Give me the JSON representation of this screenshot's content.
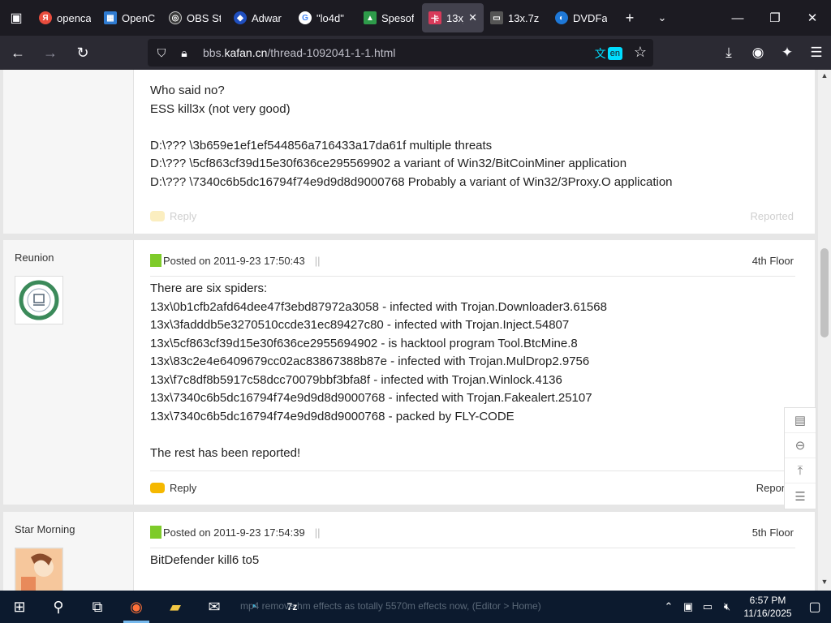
{
  "browser": {
    "tabs": [
      {
        "label": "openca",
        "favicon": "yandex-icon",
        "color": "#e84c3d"
      },
      {
        "label": "OpenC",
        "favicon": "windows-icon",
        "color": "#2f7bd1"
      },
      {
        "label": "OBS St",
        "favicon": "obs-icon",
        "color": "#3a3a3a"
      },
      {
        "label": "Adwar",
        "favicon": "adware-icon",
        "color": "#1f4fbf"
      },
      {
        "label": "\"lo4d\"",
        "favicon": "google-icon",
        "color": "#ffffff"
      },
      {
        "label": "Spesof",
        "favicon": "spesoft-icon",
        "color": "#2e9b4a"
      },
      {
        "label": "13x_",
        "favicon": "kafan-icon",
        "color": "#d83a5a"
      },
      {
        "label": "13x.7z",
        "favicon": "folder-icon",
        "color": "#555555"
      },
      {
        "label": "DVDFa",
        "favicon": "dvdfab-icon",
        "color": "#1e78d7"
      }
    ],
    "url_prefix": "bbs.",
    "url_domain": "kafan.cn",
    "url_path": "/thread-1092041-1-1.html",
    "translate_lang": "en"
  },
  "posts": [
    {
      "body": "Who said no?\nESS kill3x (not very good)\n\nD:\\??? \\3b659e1ef1ef544856a716433a17da61f multiple threats\nD:\\??? \\5cf863cf39d15e30f636ce295569902 a variant of Win32/BitCoinMiner application\nD:\\??? \\7340c6b5dc16794f74e9d9d8d9000768 Probably a variant of Win32/3Proxy.O application",
      "reply_label": "Reply",
      "reported_label": "Reported"
    },
    {
      "author": "Reunion",
      "posted": "Posted on 2011-9-23 17:50:43",
      "separator": "||",
      "floor": "4th Floor",
      "body": "There are six spiders:\n13x\\0b1cfb2afd64dee47f3ebd87972a3058 - infected with Trojan.Downloader3.61568\n13x\\3fadddb5e3270510ccde31ec89427c80 - infected with Trojan.Inject.54807\n13x\\5cf863cf39d15e30f636ce2955694902 - is hacktool program Tool.BtcMine.8\n13x\\83c2e4e6409679cc02ac83867388b87e - infected with Trojan.MulDrop2.9756\n13x\\f7c8df8b5917c58dcc70079bbf3bfa8f - infected with Trojan.Winlock.4136\n13x\\7340c6b5dc16794f74e9d9d8d9000768 - infected with Trojan.Fakealert.25107\n13x\\7340c6b5dc16794f74e9d9d8d9000768 - packed by FLY-CODE\n\nThe rest has been reported!",
      "reply_label": "Reply",
      "reported_label": "Reporte"
    },
    {
      "author": "Star Morning",
      "posted": "Posted on 2011-9-23 17:54:39",
      "separator": "||",
      "floor": "5th Floor",
      "body": "BitDefender kill6 to5"
    }
  ],
  "taskbar": {
    "tip_text": "mp4 remove hm effects as totally 5570m effects now, (Editor > Home)",
    "clock_time": "6:57 PM",
    "clock_date": "11/16/2025"
  }
}
